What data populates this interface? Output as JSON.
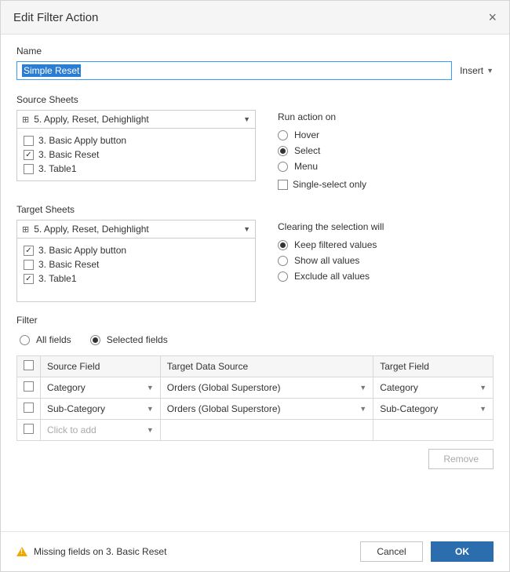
{
  "title": "Edit Filter Action",
  "name_label": "Name",
  "name_value": "Simple Reset",
  "insert_label": "Insert",
  "source_sheets_label": "Source Sheets",
  "source_dashboard": "5. Apply, Reset, Dehighlight",
  "source_items": [
    {
      "label": "3. Basic Apply button",
      "checked": false
    },
    {
      "label": "3. Basic Reset",
      "checked": true
    },
    {
      "label": "3. Table1",
      "checked": false
    }
  ],
  "run_action_label": "Run action on",
  "run_options": [
    {
      "label": "Hover",
      "selected": false
    },
    {
      "label": "Select",
      "selected": true
    },
    {
      "label": "Menu",
      "selected": false
    }
  ],
  "single_select_label": "Single-select only",
  "target_sheets_label": "Target Sheets",
  "target_dashboard": "5. Apply, Reset, Dehighlight",
  "target_items": [
    {
      "label": "3. Basic Apply button",
      "checked": true
    },
    {
      "label": "3. Basic Reset",
      "checked": false
    },
    {
      "label": "3. Table1",
      "checked": true
    }
  ],
  "clearing_label": "Clearing the selection will",
  "clearing_options": [
    {
      "label": "Keep filtered values",
      "selected": true
    },
    {
      "label": "Show all values",
      "selected": false
    },
    {
      "label": "Exclude all values",
      "selected": false
    }
  ],
  "filter_label": "Filter",
  "filter_scope": [
    {
      "label": "All fields",
      "selected": false
    },
    {
      "label": "Selected fields",
      "selected": true
    }
  ],
  "table_headers": {
    "source": "Source Field",
    "ds": "Target Data Source",
    "target": "Target Field"
  },
  "table_rows": [
    {
      "source": "Category",
      "ds": "Orders (Global Superstore)",
      "target": "Category"
    },
    {
      "source": "Sub-Category",
      "ds": "Orders (Global Superstore)",
      "target": "Sub-Category"
    }
  ],
  "add_row_text": "Click to add",
  "remove_label": "Remove",
  "warning_text": "Missing fields on 3. Basic Reset",
  "cancel_label": "Cancel",
  "ok_label": "OK"
}
